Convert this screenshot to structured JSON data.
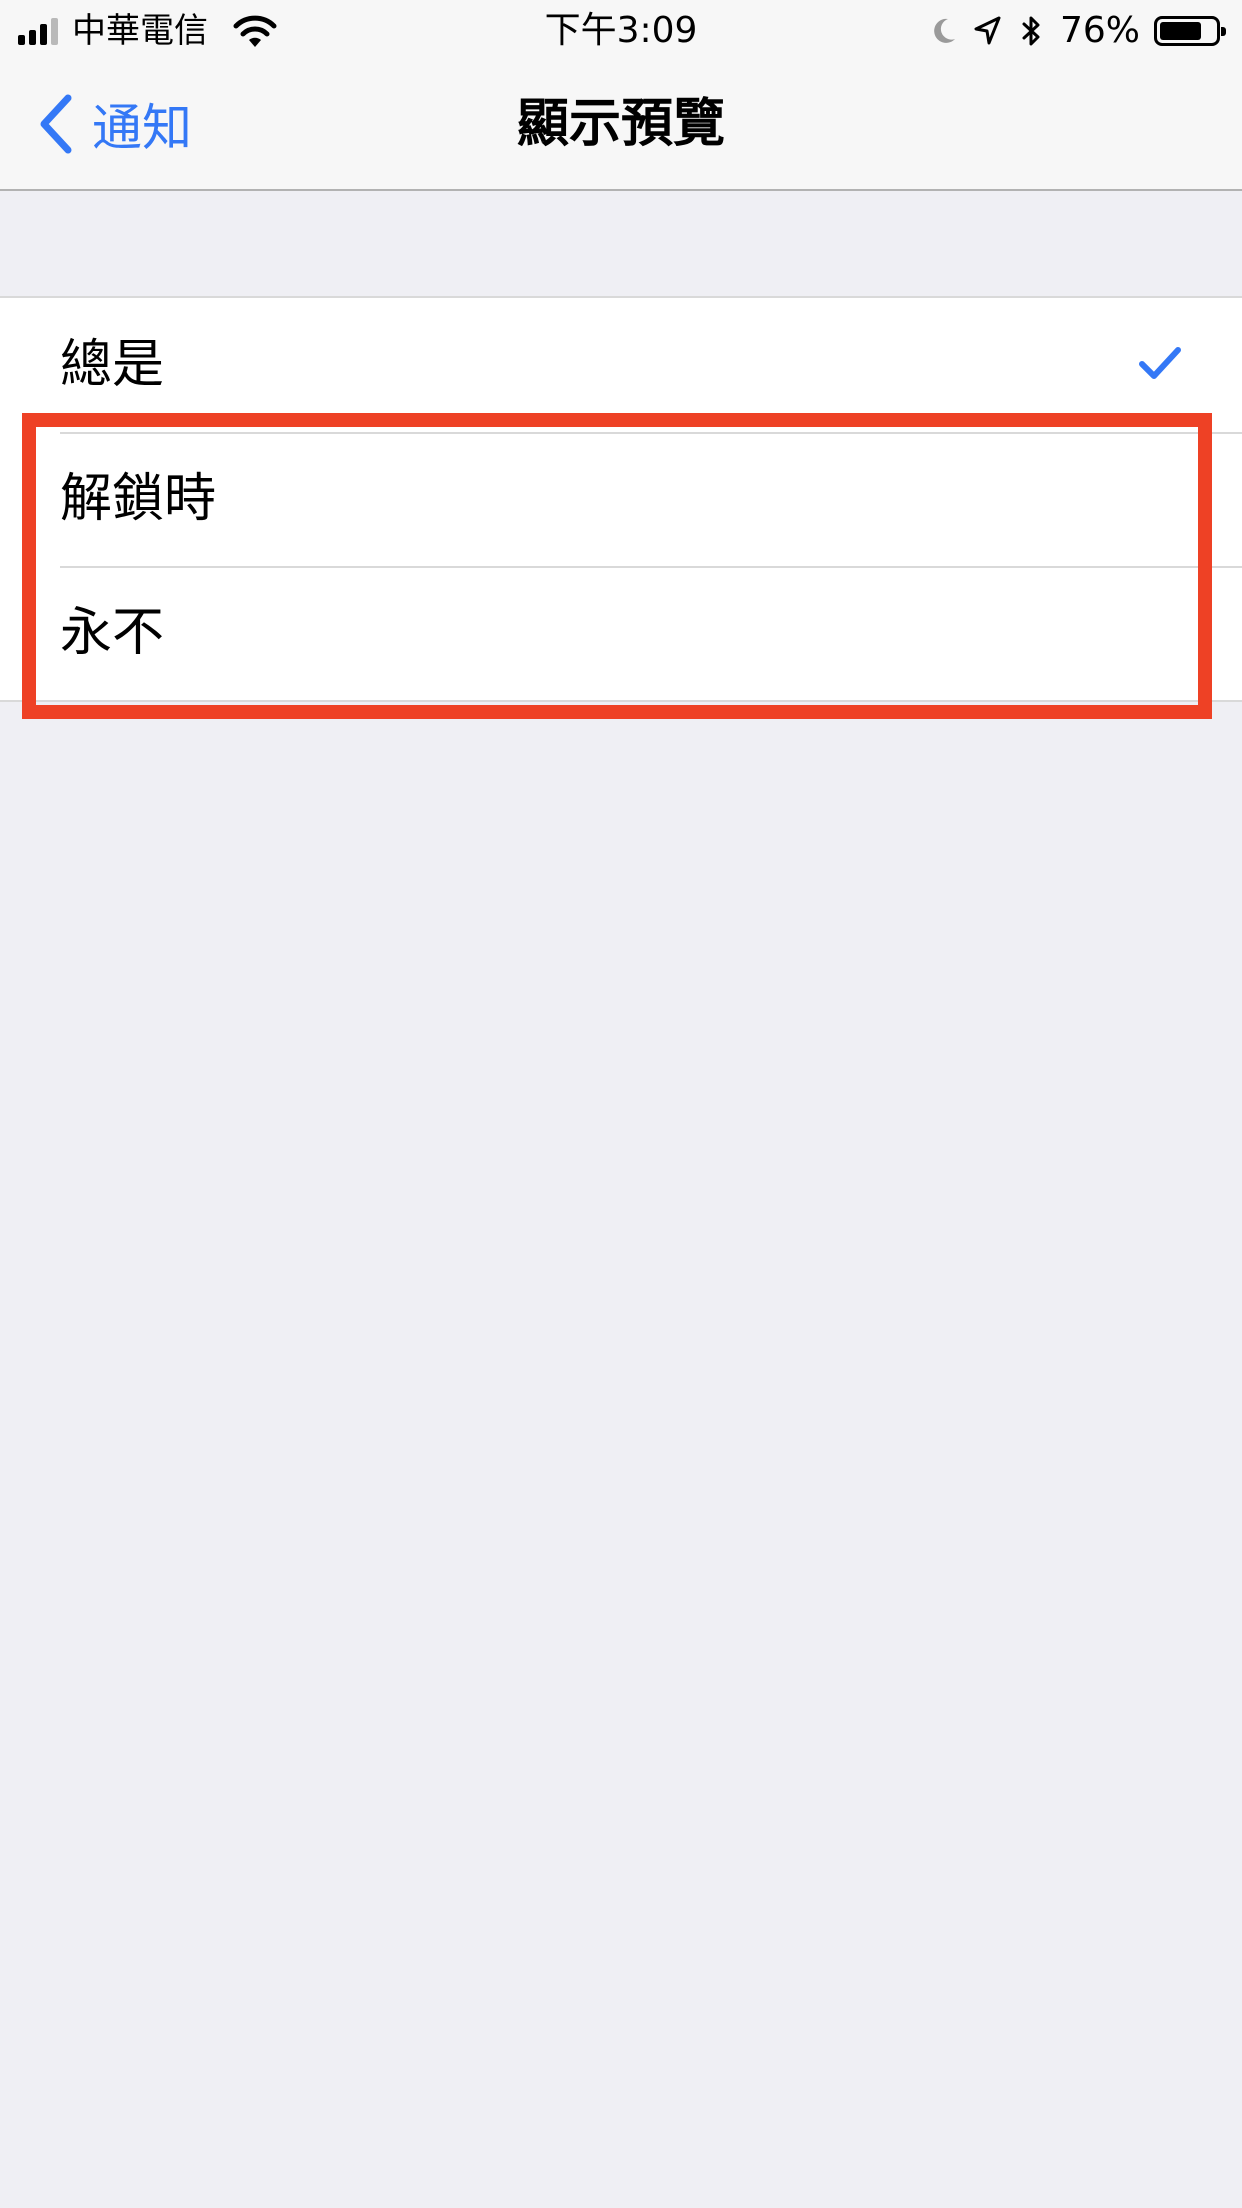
{
  "status_bar": {
    "carrier": "中華電信",
    "time": "下午3:09",
    "battery_percent": "76%",
    "battery_level": 0.76,
    "signal_bars_filled": 3,
    "signal_bars_total": 4
  },
  "nav": {
    "back_label": "通知",
    "title": "顯示預覽"
  },
  "options": [
    {
      "label": "總是",
      "selected": true
    },
    {
      "label": "解鎖時",
      "selected": false
    },
    {
      "label": "永不",
      "selected": false
    }
  ],
  "colors": {
    "accent": "#3478f6",
    "highlight": "#ee4125",
    "background": "#efeff4"
  },
  "icons": {
    "signal": "cellular-signal-icon",
    "wifi": "wifi-icon",
    "moon": "moon-icon",
    "location": "location-arrow-icon",
    "bluetooth": "bluetooth-icon",
    "battery": "battery-icon",
    "back": "chevron-left-icon",
    "check": "checkmark-icon"
  }
}
